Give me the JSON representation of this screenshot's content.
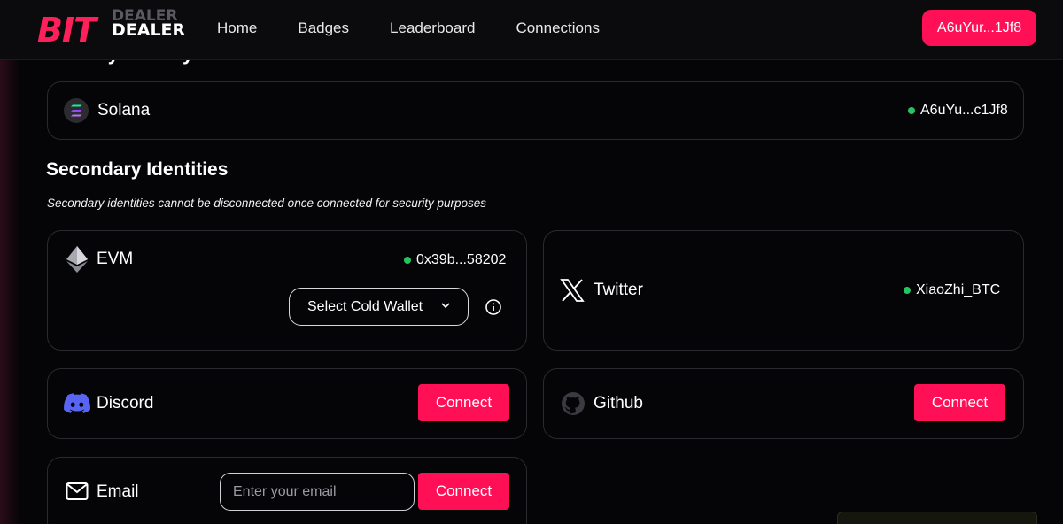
{
  "header": {
    "logo_main": "BIT",
    "logo_shadow": "DEALER",
    "logo_sub": "DEALER",
    "nav": [
      "Home",
      "Badges",
      "Leaderboard",
      "Connections"
    ],
    "wallet_button": "A6uYur...1Jf8"
  },
  "primary": {
    "title": "Primary Identity",
    "solana": {
      "label": "Solana",
      "address": "A6uYu...c1Jf8",
      "icon": "solana-icon"
    }
  },
  "secondary": {
    "title": "Secondary Identities",
    "note": "Secondary identities cannot be disconnected once connected for security purposes",
    "evm": {
      "label": "EVM",
      "address": "0x39b...58202",
      "select_label": "Select Cold Wallet",
      "icon": "ethereum-icon"
    },
    "twitter": {
      "label": "Twitter",
      "handle": "XiaoZhi_BTC",
      "icon": "x-icon"
    },
    "discord": {
      "label": "Discord",
      "button": "Connect",
      "icon": "discord-icon"
    },
    "github": {
      "label": "Github",
      "button": "Connect",
      "icon": "github-icon"
    },
    "email": {
      "label": "Email",
      "placeholder": "Enter your email",
      "button": "Connect",
      "icon": "mail-icon"
    }
  },
  "colors": {
    "accent": "#ff0f55",
    "connected_dot": "#22c55e",
    "background": "#050406",
    "card_border": "#2a2a2e"
  }
}
